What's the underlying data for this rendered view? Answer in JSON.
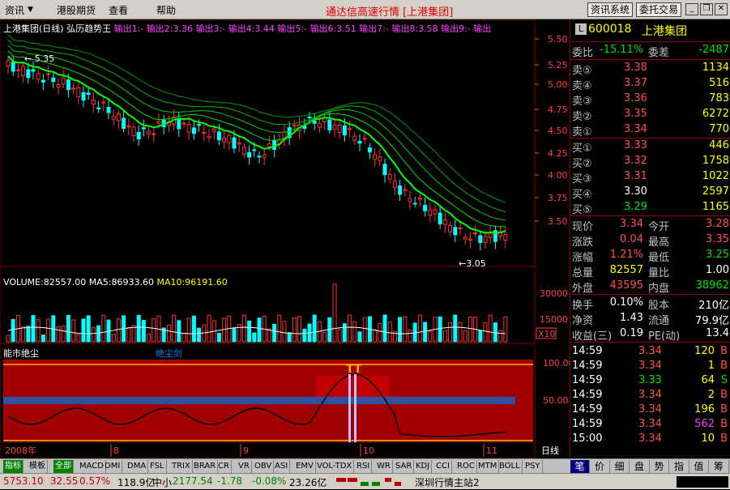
{
  "menu": {
    "items": [
      "资讯",
      "港股期货",
      "查看",
      "帮助"
    ],
    "title": "通达信高速行情 [上港集团]",
    "btn_info": "资讯系统",
    "btn_trade": "委托交易"
  },
  "chart_header": {
    "name": "上港集团(日线)",
    "indicator": "弘历趋势王",
    "outputs": [
      "输出1:-",
      "输出2:3.36",
      "输出3:-",
      "输出4:3.44",
      "输出5:-",
      "输出6:3.51",
      "输出7:-",
      "输出8:3.58",
      "输出9:-",
      "输出"
    ]
  },
  "price_labels": [
    "5.50",
    "5.25",
    "5.00",
    "4.75",
    "4.50",
    "4.25",
    "4.00",
    "3.75",
    "3.50"
  ],
  "high_label": "5.35",
  "low_label": "3.05",
  "volume_header": {
    "vol": "VOLUME:82557.00",
    "ma5": "MA5:86933.60",
    "ma10": "MA10:96191.60"
  },
  "volume_labels": [
    "30000",
    "15000"
  ],
  "volume_unit": "X10",
  "ind_header": {
    "name": "能市绝尘",
    "sub": "绝尘剑"
  },
  "ind_labels": [
    "100.00",
    "50.00"
  ],
  "date_axis": {
    "year": "2008年",
    "months": [
      "8",
      "9",
      "10",
      "11"
    ],
    "period": "日线"
  },
  "quote": {
    "code": "600018",
    "name": "上港集团",
    "logo": "L",
    "ratio_label": "委比",
    "ratio": "-15.11%",
    "diff_label": "委差",
    "diff": "-2487",
    "asks": [
      {
        "label": "卖⑤",
        "price": "3.38",
        "vol": "1134"
      },
      {
        "label": "卖④",
        "price": "3.37",
        "vol": "516"
      },
      {
        "label": "卖③",
        "price": "3.36",
        "vol": "783"
      },
      {
        "label": "卖②",
        "price": "3.35",
        "vol": "6272"
      },
      {
        "label": "卖①",
        "price": "3.34",
        "vol": "770"
      }
    ],
    "bids": [
      {
        "label": "买①",
        "price": "3.33",
        "vol": "446"
      },
      {
        "label": "买②",
        "price": "3.32",
        "vol": "1758"
      },
      {
        "label": "买③",
        "price": "3.31",
        "vol": "1022"
      },
      {
        "label": "买④",
        "price": "3.30",
        "vol": "2597"
      },
      {
        "label": "买⑤",
        "price": "3.29",
        "vol": "1165"
      }
    ],
    "stats": [
      {
        "l1": "现价",
        "v1": "3.34",
        "l2": "今开",
        "v2": "3.28"
      },
      {
        "l1": "涨跌",
        "v1": "0.04",
        "l2": "最高",
        "v2": "3.35"
      },
      {
        "l1": "涨幅",
        "v1": "1.21%",
        "l2": "最低",
        "v2": "3.25"
      },
      {
        "l1": "总量",
        "v1": "82557",
        "l2": "量比",
        "v2": "1.00"
      },
      {
        "l1": "外盘",
        "v1": "43595",
        "l2": "内盘",
        "v2": "38962"
      }
    ],
    "stats2": [
      {
        "l1": "换手",
        "v1": "0.10%",
        "l2": "股本",
        "v2": "210亿"
      },
      {
        "l1": "净资",
        "v1": "1.43",
        "l2": "流通",
        "v2": "79.9亿"
      },
      {
        "l1": "收益(三)",
        "v1": "0.19",
        "l2": "PE(动)",
        "v2": "13.4"
      }
    ],
    "ticks": [
      {
        "time": "14:59",
        "price": "3.34",
        "vol": "120",
        "side": "B"
      },
      {
        "time": "14:59",
        "price": "3.34",
        "vol": "1",
        "side": "B"
      },
      {
        "time": "14:59",
        "price": "3.33",
        "vol": "64",
        "side": "S"
      },
      {
        "time": "14:59",
        "price": "3.34",
        "vol": "2",
        "side": "B"
      },
      {
        "time": "14:59",
        "price": "3.34",
        "vol": "196",
        "side": "B"
      },
      {
        "time": "14:59",
        "price": "3.34",
        "vol": "562",
        "side": "B"
      },
      {
        "time": "15:00",
        "price": "3.34",
        "vol": "10",
        "side": "B"
      }
    ]
  },
  "tabs": [
    "指标",
    "模板",
    "全部",
    "MACD",
    "DMI",
    "DMA",
    "FSL",
    "TRIX",
    "BRAR",
    "CR",
    "VR",
    "OBV",
    "ASI",
    "EMV",
    "VOL-TDX",
    "RSI",
    "WR",
    "SAR",
    "KDJ",
    "CCI",
    "ROC",
    "MTM",
    "BOLL",
    "PSY"
  ],
  "right_tabs": [
    "笔",
    "价",
    "细",
    "盘",
    "势",
    "指",
    "值",
    "筹"
  ],
  "status": {
    "index1": "5753.10",
    "chg1": "32.55",
    "pct1": "0.57%",
    "amt1": "118.9亿",
    "label2": "中小",
    "index2": "2177.54",
    "chg2": "-1.78",
    "pct2": "-0.08%",
    "amt2": "23.26亿",
    "server": "深圳行情主站2"
  },
  "colors": {
    "up": "#ff3030",
    "down": "#00ffff",
    "ma": "#00ff00",
    "panel_bg": "#a00000"
  }
}
